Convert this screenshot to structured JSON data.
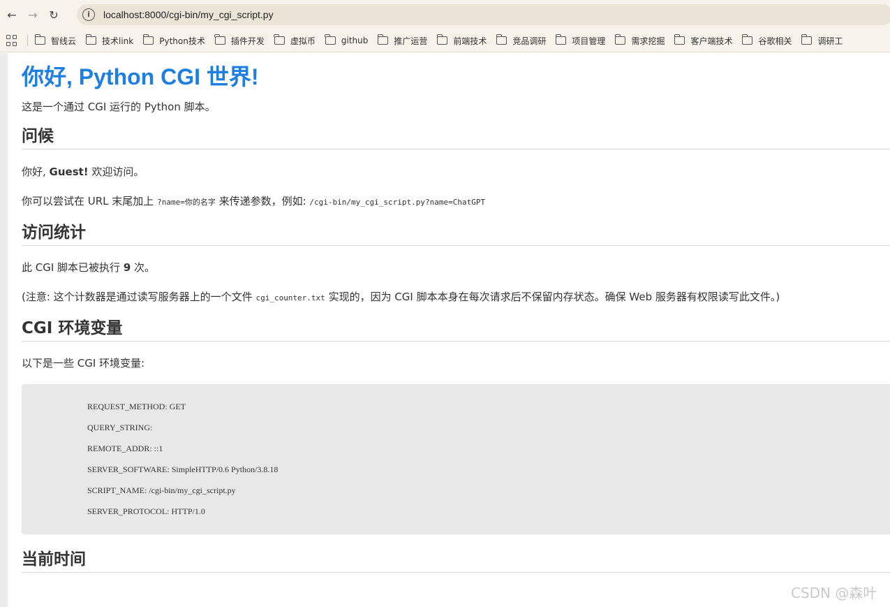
{
  "browser": {
    "url": "localhost:8000/cgi-bin/my_cgi_script.py",
    "bookmarks": [
      "智线云",
      "技术link",
      "Python技术",
      "插件开发",
      "虚拟币",
      "github",
      "推广运营",
      "前端技术",
      "竞品调研",
      "项目管理",
      "需求挖掘",
      "客户端技术",
      "谷歌相关",
      "调研工"
    ]
  },
  "page": {
    "title": "你好, Python CGI 世界!",
    "intro": "这是一个通过 CGI 运行的 Python 脚本。",
    "greeting": {
      "heading": "问候",
      "hello_prefix": "你好, ",
      "name": "Guest!",
      "hello_suffix": " 欢迎访问。",
      "tip_prefix": "你可以尝试在 URL 末尾加上 ",
      "tip_code": "?name=你的名字",
      "tip_middle": " 来传递参数，例如: ",
      "tip_example": "/cgi-bin/my_cgi_script.py?name=ChatGPT"
    },
    "stats": {
      "heading": "访问统计",
      "count_prefix": "此 CGI 脚本已被执行 ",
      "count": "9",
      "count_suffix": " 次。",
      "note_prefix": "(注意: 这个计数器是通过读写服务器上的一个文件 ",
      "note_file": "cgi_counter.txt",
      "note_suffix": " 实现的，因为 CGI 脚本本身在每次请求后不保留内存状态。确保 Web 服务器有权限读写此文件。)"
    },
    "env": {
      "heading": "CGI 环境变量",
      "intro": "以下是一些 CGI 环境变量:",
      "lines": [
        "REQUEST_METHOD: GET",
        "QUERY_STRING:",
        "REMOTE_ADDR: ::1",
        "SERVER_SOFTWARE: SimpleHTTP/0.6 Python/3.8.18",
        "SCRIPT_NAME: /cgi-bin/my_cgi_script.py",
        "SERVER_PROTOCOL: HTTP/1.0"
      ]
    },
    "time": {
      "heading": "当前时间"
    }
  },
  "watermark": "CSDN @森叶"
}
